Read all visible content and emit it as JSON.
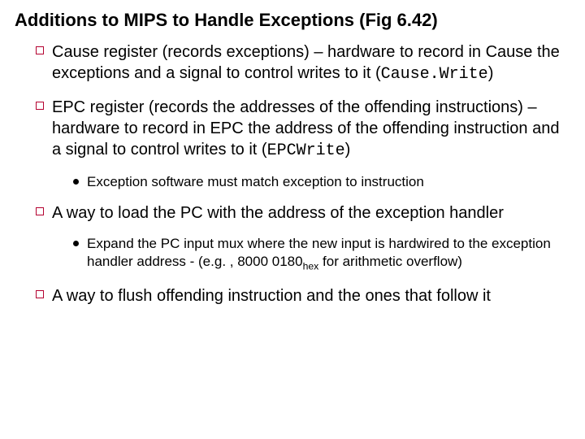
{
  "title": "Additions to MIPS to Handle Exceptions (Fig 6.42)",
  "items": [
    {
      "pre": "Cause register (records exceptions) – hardware to record in Cause the exceptions and a signal to control writes to it (",
      "code": "Cause.Write",
      "post": ")"
    },
    {
      "pre": "EPC register (records the addresses of the offending instructions) – hardware to record in EPC the address of the offending instruction and a signal to control writes to it (",
      "code": "EPCWrite",
      "post": ")",
      "sub": [
        {
          "text": "Exception software must match exception to instruction"
        }
      ]
    },
    {
      "pre": "A way to load the PC with the address of the exception handler",
      "sub": [
        {
          "text_a": "Expand the PC input mux where the new input is hardwired to the exception handler address - (e.g. , 8000 0180",
          "subscript": "hex",
          "text_b": " for arithmetic overflow)"
        }
      ]
    },
    {
      "pre": "A way to flush offending instruction and the ones that follow it"
    }
  ]
}
